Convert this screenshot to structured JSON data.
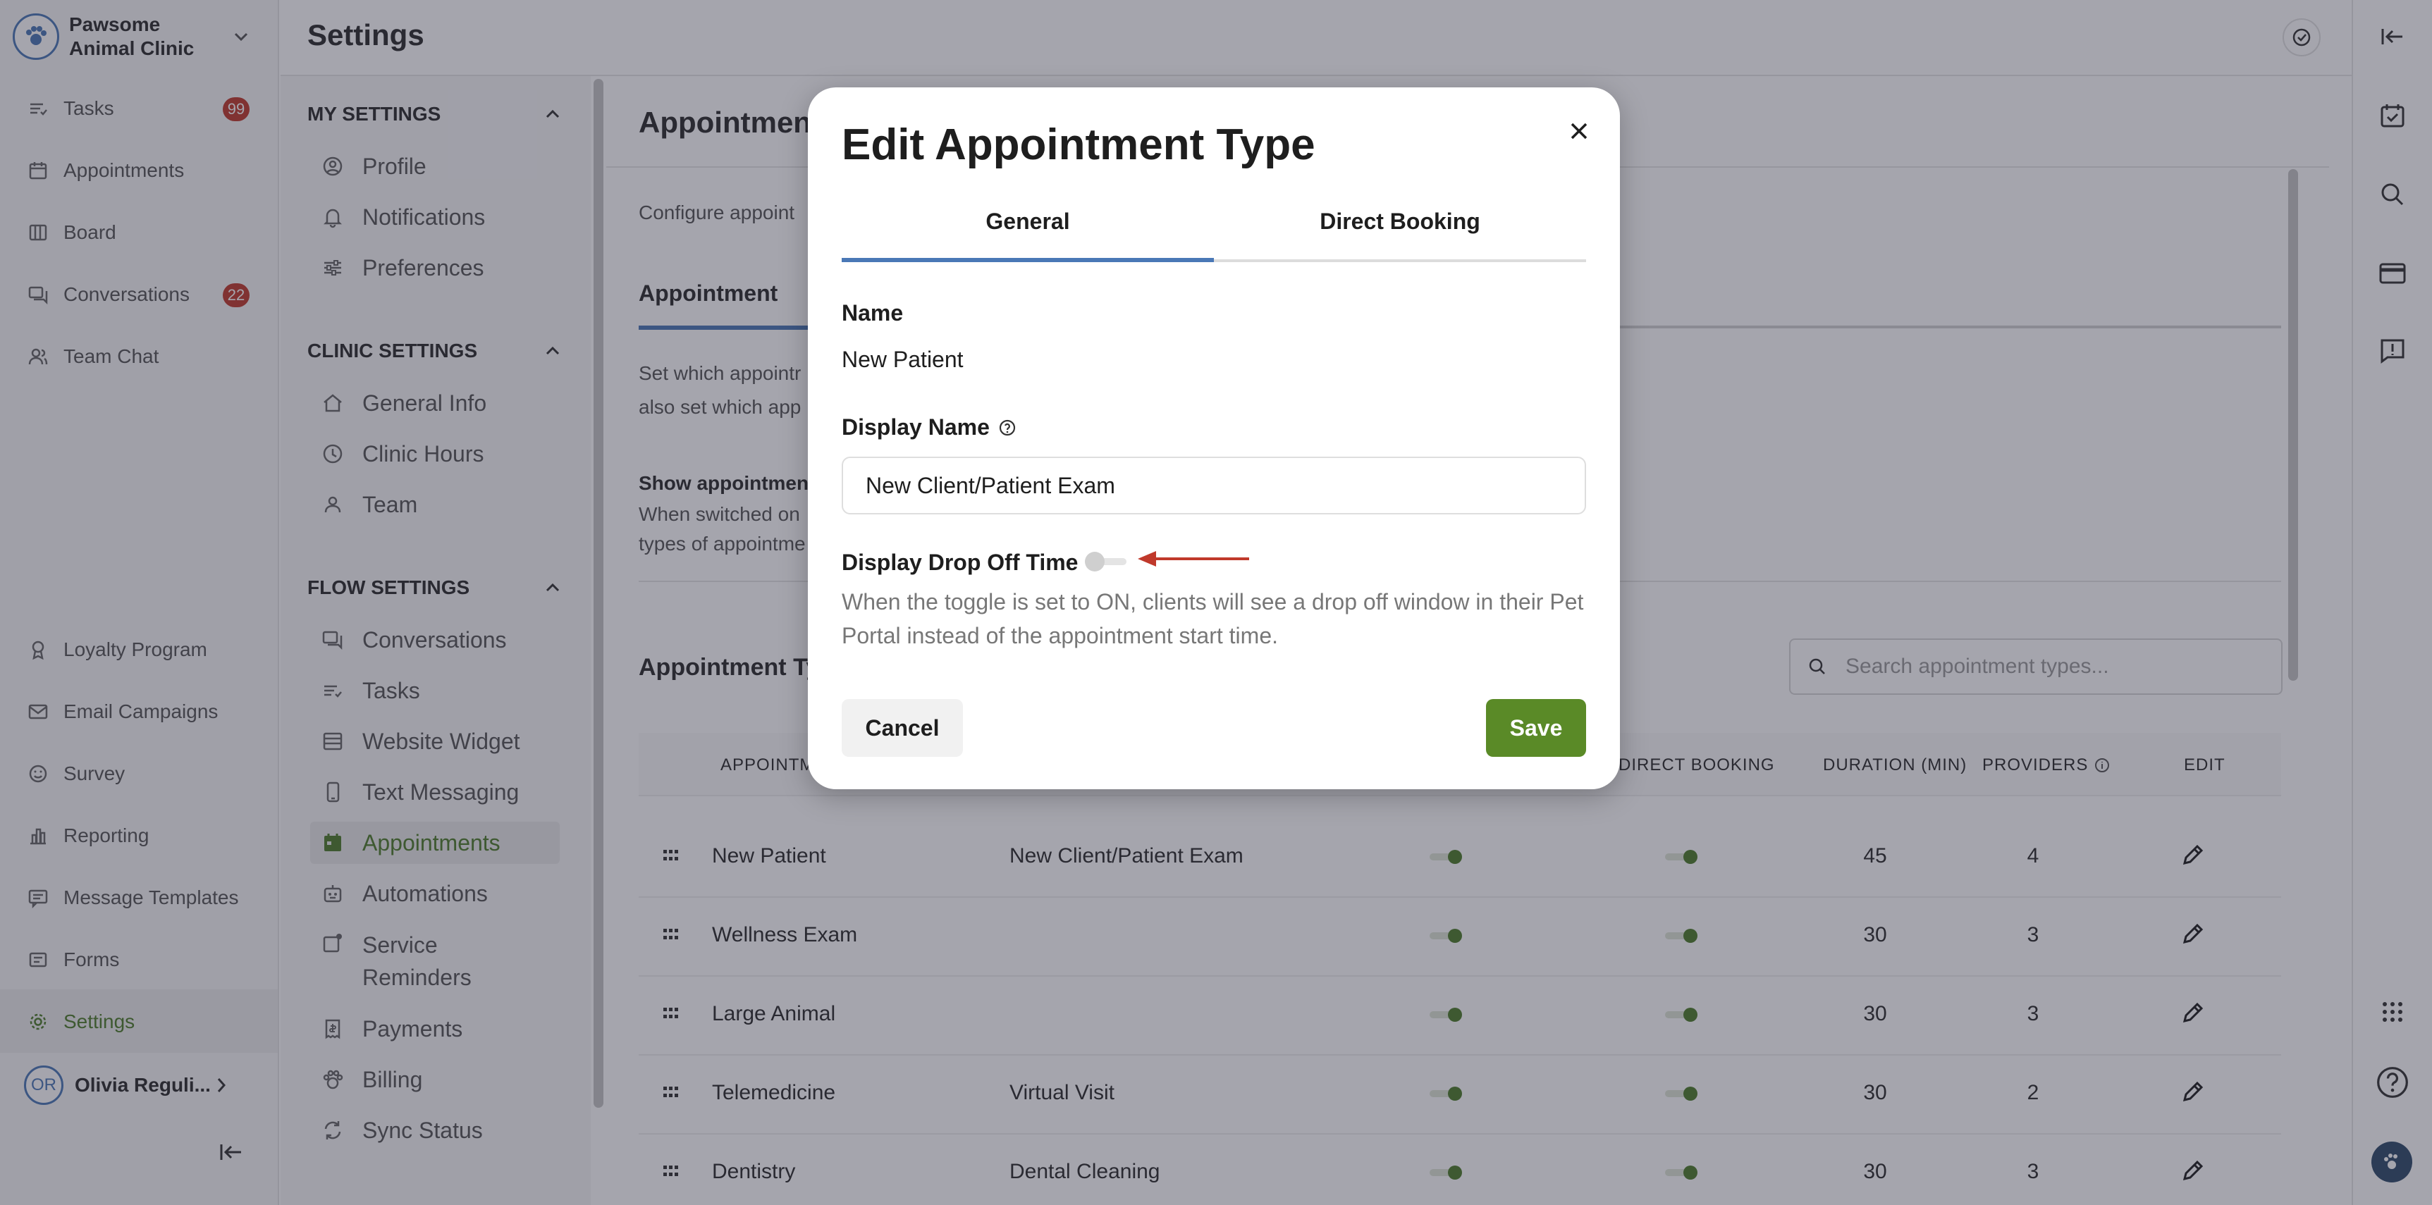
{
  "nav": {
    "clinic_name": "Pawsome Animal Clinic",
    "items": [
      {
        "label": "Tasks",
        "badge": "99",
        "icon": "tasks-icon"
      },
      {
        "label": "Appointments",
        "icon": "calendar-icon"
      },
      {
        "label": "Board",
        "icon": "board-icon"
      },
      {
        "label": "Conversations",
        "badge": "22",
        "icon": "chat-icon"
      },
      {
        "label": "Team Chat",
        "icon": "team-icon"
      },
      {
        "label": "Loyalty Program",
        "icon": "loyalty-icon"
      },
      {
        "label": "Email Campaigns",
        "icon": "mail-icon"
      },
      {
        "label": "Survey",
        "icon": "smile-icon"
      },
      {
        "label": "Reporting",
        "icon": "chart-icon"
      },
      {
        "label": "Message Templates",
        "icon": "message-icon"
      },
      {
        "label": "Forms",
        "icon": "forms-icon"
      },
      {
        "label": "Settings",
        "icon": "gear-icon"
      }
    ],
    "user": {
      "initials": "OR",
      "name": "Olivia Reguli..."
    }
  },
  "page": {
    "title": "Settings"
  },
  "settings_nav": {
    "my_settings": {
      "title": "MY SETTINGS",
      "items": [
        "Profile",
        "Notifications",
        "Preferences"
      ]
    },
    "clinic_settings": {
      "title": "CLINIC SETTINGS",
      "items": [
        "General Info",
        "Clinic Hours",
        "Team"
      ]
    },
    "flow_settings": {
      "title": "FLOW SETTINGS",
      "items": [
        "Conversations",
        "Tasks",
        "Website Widget",
        "Text Messaging",
        "Appointments",
        "Automations",
        "Service Reminders",
        "Payments",
        "Billing",
        "Sync Status"
      ]
    }
  },
  "main": {
    "heading": "Appointment",
    "configure_text": "Configure appoint",
    "tab_label": "Appointment",
    "desc_line1": "Set which appointr",
    "desc_line2": "also set which app",
    "show_title": "Show appointment",
    "show_line1": "When switched on",
    "show_line2": "types of appointme",
    "types_heading": "Appointment Ty",
    "search_placeholder": "Search appointment types...",
    "columns": {
      "name": "APPOINTM",
      "direct": "DIRECT BOOKING",
      "duration": "DURATION (MIN)",
      "providers": "PROVIDERS",
      "edit": "EDIT"
    },
    "rows": [
      {
        "name": "New Patient",
        "display": "New Client/Patient Exam",
        "duration": "45",
        "providers": "4"
      },
      {
        "name": "Wellness Exam",
        "display": "",
        "duration": "30",
        "providers": "3"
      },
      {
        "name": "Large Animal",
        "display": "",
        "duration": "30",
        "providers": "3"
      },
      {
        "name": "Telemedicine",
        "display": "Virtual Visit",
        "duration": "30",
        "providers": "2"
      },
      {
        "name": "Dentistry",
        "display": "Dental Cleaning",
        "duration": "30",
        "providers": "3"
      }
    ]
  },
  "modal": {
    "title": "Edit Appointment Type",
    "tabs": [
      "General",
      "Direct Booking"
    ],
    "name_label": "Name",
    "name_value": "New Patient",
    "display_name_label": "Display Name",
    "display_name_value": "New Client/Patient Exam",
    "drop_off_label": "Display Drop Off Time",
    "drop_off_on": false,
    "help_text": "When the toggle is set to ON, clients will see a drop off window in their Pet Portal instead of the appointment start time.",
    "cancel": "Cancel",
    "save": "Save"
  },
  "colors": {
    "accent": "#5a8a27",
    "tab": "#4a78b6",
    "badge": "#c0392b",
    "annotation": "#c0392b"
  }
}
